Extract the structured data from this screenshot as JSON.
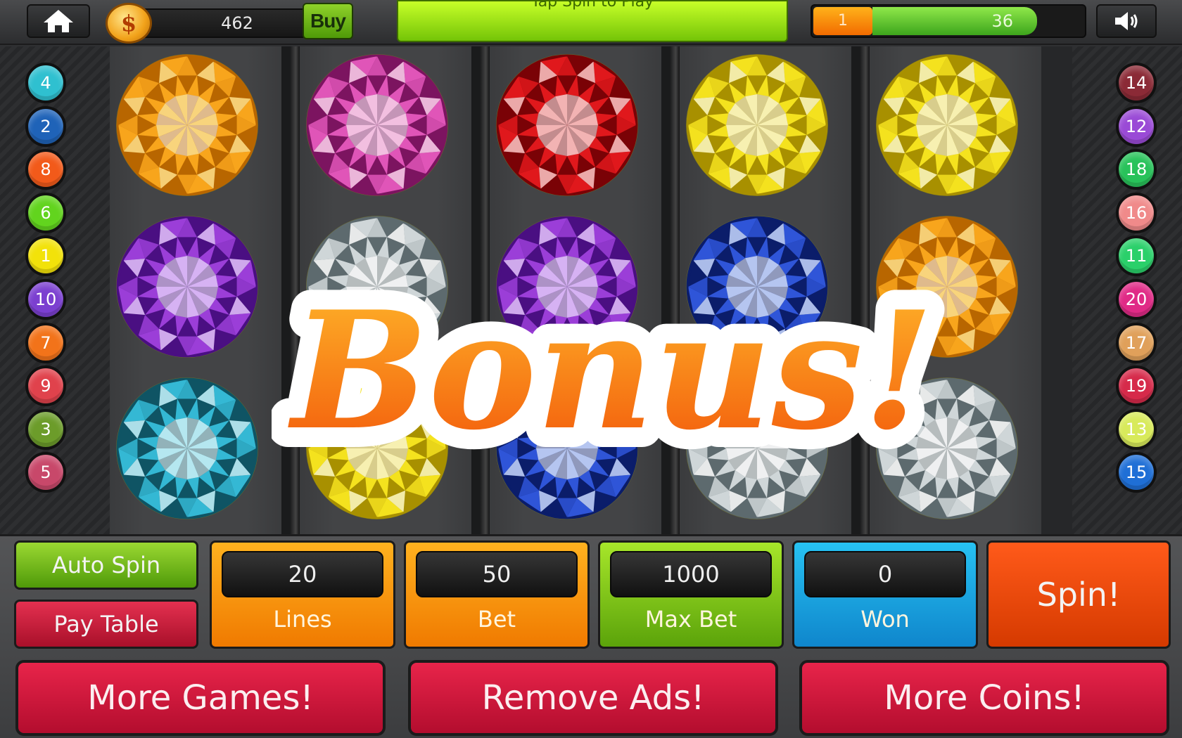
{
  "topbar": {
    "coins": "462",
    "buy_label": "Buy",
    "coin_symbol": "$",
    "message": "Tap Spin to Play",
    "level": "1",
    "xp": "36",
    "xp_fraction": 0.78
  },
  "left_lines": [
    {
      "label": "4",
      "color": "#2fc0d0"
    },
    {
      "label": "2",
      "color": "#1f63b8"
    },
    {
      "label": "8",
      "color": "#f25a1a"
    },
    {
      "label": "6",
      "color": "#62d41e"
    },
    {
      "label": "1",
      "color": "#f2e20a"
    },
    {
      "label": "10",
      "color": "#7b3fd0"
    },
    {
      "label": "7",
      "color": "#f2731a"
    },
    {
      "label": "9",
      "color": "#e0424c"
    },
    {
      "label": "3",
      "color": "#6c9c2a"
    },
    {
      "label": "5",
      "color": "#c8486a"
    }
  ],
  "right_lines": [
    {
      "label": "14",
      "color": "#8b2a36"
    },
    {
      "label": "12",
      "color": "#9a4ad6"
    },
    {
      "label": "18",
      "color": "#28c25a"
    },
    {
      "label": "16",
      "color": "#f08a8a"
    },
    {
      "label": "11",
      "color": "#2ad06a"
    },
    {
      "label": "20",
      "color": "#e02a86"
    },
    {
      "label": "17",
      "color": "#e0a05a"
    },
    {
      "label": "19",
      "color": "#d62a4a"
    },
    {
      "label": "13",
      "color": "#d8ea5a"
    },
    {
      "label": "15",
      "color": "#1f6fd6"
    }
  ],
  "reels": [
    [
      "orange-gem",
      "purple-gem",
      "teal-gem"
    ],
    [
      "pink-gem",
      "white-gem",
      "yellow-gem"
    ],
    [
      "red-gem",
      "purple-gem",
      "blue-gem"
    ],
    [
      "yellow-gem",
      "blue-gem",
      "white-gem"
    ],
    [
      "yellow-gem",
      "orange-gem",
      "white-gem"
    ]
  ],
  "gem_colors": {
    "orange-gem": {
      "light": "#ffe08a",
      "mid": "#f8a51c",
      "dark": "#b86600"
    },
    "purple-gem": {
      "light": "#e6c4ff",
      "mid": "#9b3ed8",
      "dark": "#4a0f82"
    },
    "teal-gem": {
      "light": "#c8f7ff",
      "mid": "#34b8d4",
      "dark": "#0f5464"
    },
    "pink-gem": {
      "light": "#ffd2ee",
      "mid": "#e055b8",
      "dark": "#7c1460"
    },
    "white-gem": {
      "light": "#ffffff",
      "mid": "#cfd6d8",
      "dark": "#5d6a6e"
    },
    "yellow-gem": {
      "light": "#fffbc4",
      "mid": "#f4e21e",
      "dark": "#a89000"
    },
    "red-gem": {
      "light": "#ffc7c7",
      "mid": "#e0181c",
      "dark": "#7a0206"
    },
    "blue-gem": {
      "light": "#c8d8ff",
      "mid": "#2f55d8",
      "dark": "#0b1d6a"
    }
  },
  "bonus_text": "Bonus!",
  "controls": {
    "auto_spin": "Auto Spin",
    "pay_table": "Pay Table",
    "lines": {
      "value": "20",
      "label": "Lines"
    },
    "bet": {
      "value": "50",
      "label": "Bet"
    },
    "max_bet": {
      "value": "1000",
      "label": "Max Bet"
    },
    "won": {
      "value": "0",
      "label": "Won"
    },
    "spin": "Spin!"
  },
  "bottom_buttons": {
    "more_games": "More Games!",
    "remove_ads": "Remove Ads!",
    "more_coins": "More Coins!"
  }
}
